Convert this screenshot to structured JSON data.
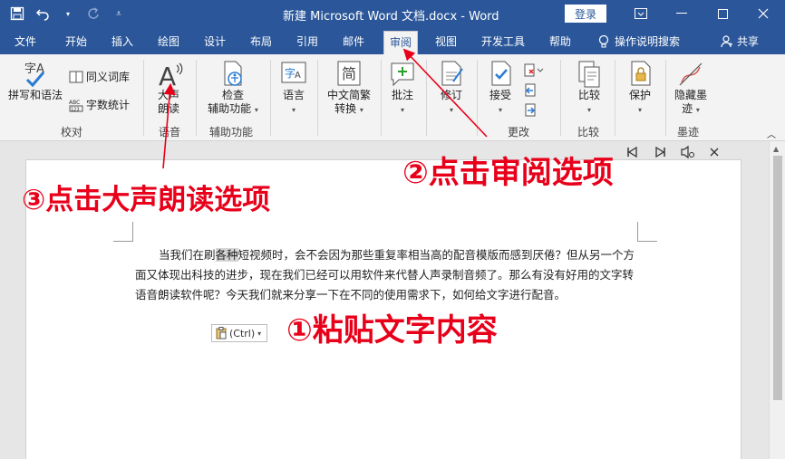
{
  "titlebar": {
    "title": "新建 Microsoft Word 文档.docx  -  Word",
    "login_label": "登录",
    "bg_color": "#2b579a"
  },
  "tabs": [
    {
      "label": "文件"
    },
    {
      "label": "开始"
    },
    {
      "label": "插入"
    },
    {
      "label": "绘图"
    },
    {
      "label": "设计"
    },
    {
      "label": "布局"
    },
    {
      "label": "引用"
    },
    {
      "label": "邮件"
    },
    {
      "label": "审阅",
      "active": true
    },
    {
      "label": "视图"
    },
    {
      "label": "开发工具"
    },
    {
      "label": "帮助"
    }
  ],
  "tell_me": "操作说明搜索",
  "share": "共享",
  "ribbon": {
    "proofing": {
      "spell": "拼写和语法",
      "thesaurus": "同义词库",
      "wordcount": "字数统计",
      "label": "校对"
    },
    "speech": {
      "read_aloud_1": "大声",
      "read_aloud_2": "朗读",
      "label": "语音"
    },
    "accessibility": {
      "check_1": "检查",
      "check_2": "辅助功能",
      "label": "辅助功能"
    },
    "language": {
      "btn": "语言"
    },
    "chinese": {
      "btn_1": "中文简繁",
      "btn_2": "转换"
    },
    "comments": {
      "btn": "批注"
    },
    "tracking": {
      "btn": "修订"
    },
    "changes": {
      "accept": "接受",
      "label": "更改"
    },
    "compare": {
      "btn": "比较",
      "label": "比较"
    },
    "protect": {
      "btn": "保护"
    },
    "ink": {
      "btn_1": "隐藏墨",
      "btn_2": "迹",
      "label": "墨迹"
    }
  },
  "document": {
    "text_before": "当我们在刷",
    "text_highlight": "各种",
    "text_after": "短视频时，会不会因为那些重复率相当高的配音模版而感到厌倦？但从另一个方面又体现出科技的进步，现在我们已经可以用软件来代替人声录制音频了。那么有没有好用的文字转语音朗读软件呢？今天我们就来分享一下在不同的使用需求下，如何给文字进行配音。",
    "paste_label": "(Ctrl)"
  },
  "annotations": {
    "step1": "①粘贴文字内容",
    "step2": "②点击审阅选项",
    "step3": "③点击大声朗读选项",
    "color": "#e8001a"
  }
}
